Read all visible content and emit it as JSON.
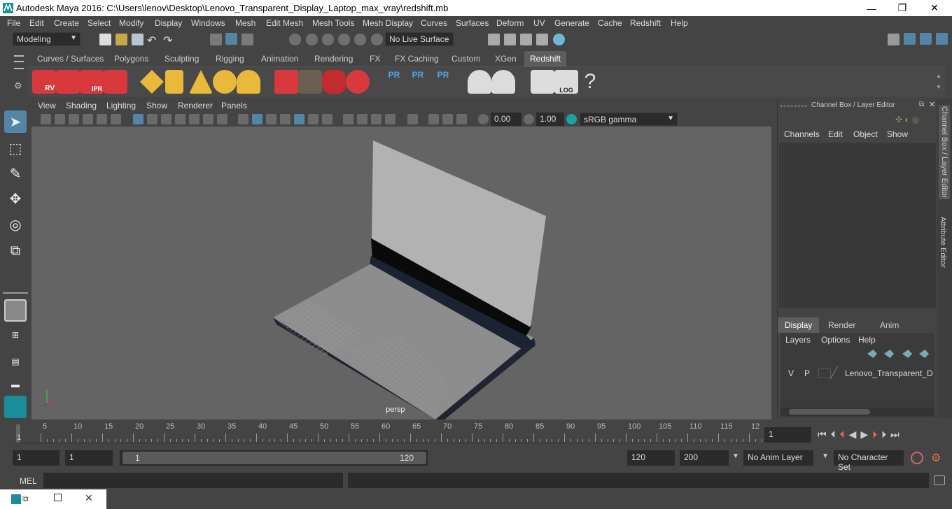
{
  "window": {
    "title": "Autodesk Maya 2016: C:\\Users\\lenov\\Desktop\\Lenovo_Transparent_Display_Laptop_max_vray\\redshift.mb",
    "minimize": "—",
    "maximize": "❐",
    "close": "✕"
  },
  "menubar": [
    "File",
    "Edit",
    "Create",
    "Select",
    "Modify",
    "Display",
    "Windows",
    "Mesh",
    "Edit Mesh",
    "Mesh Tools",
    "Mesh Display",
    "Curves",
    "Surfaces",
    "Deform",
    "UV",
    "Generate",
    "Cache",
    "Redshift",
    "Help"
  ],
  "status": {
    "mode": "Modeling",
    "live_surface": "No Live Surface"
  },
  "shelf_tabs": [
    "Curves / Surfaces",
    "Polygons",
    "Sculpting",
    "Rigging",
    "Animation",
    "Rendering",
    "FX",
    "FX Caching",
    "Custom",
    "XGen",
    "Redshift"
  ],
  "shelf_active": "Redshift",
  "shelf_icons": {
    "rv": "RV",
    "ipr": "IPR",
    "pr": "PR",
    "log": "LOG",
    "help": "?"
  },
  "viewport": {
    "menus": [
      "View",
      "Shading",
      "Lighting",
      "Show",
      "Renderer",
      "Panels"
    ],
    "exposure": "0.00",
    "gamma": "1.00",
    "color_space": "sRGB gamma",
    "camera_label": "persp"
  },
  "channel_panel": {
    "title": "Channel Box / Layer Editor",
    "menus": [
      "Channels",
      "Edit",
      "Object",
      "Show"
    ],
    "layer_tabs": [
      "Display",
      "Render",
      "Anim"
    ],
    "layer_active": "Display",
    "layer_menus": [
      "Layers",
      "Options",
      "Help"
    ],
    "layer": {
      "v": "V",
      "p": "P",
      "name": "Lenovo_Transparent_Dis"
    },
    "side_tabs": [
      "Channel Box / Layer Editor",
      "Attribute Editor"
    ]
  },
  "timeline": {
    "ticks": [
      "5",
      "10",
      "15",
      "20",
      "25",
      "30",
      "35",
      "40",
      "45",
      "50",
      "55",
      "60",
      "65",
      "70",
      "75",
      "80",
      "85",
      "90",
      "95",
      "100",
      "105",
      "110",
      "115",
      "12"
    ],
    "start_marker": "1",
    "current_frame": "1"
  },
  "range": {
    "start": "1",
    "playback_start": "1",
    "slider_start": "1",
    "slider_end": "120",
    "playback_end": "120",
    "end": "200",
    "anim_layer": "No Anim Layer",
    "character_set": "No Character Set"
  },
  "command": {
    "lang": "MEL"
  },
  "colors": {
    "accent": "#5285a6",
    "redshift_red": "#d8393c",
    "viewport_bg": "#646464"
  }
}
